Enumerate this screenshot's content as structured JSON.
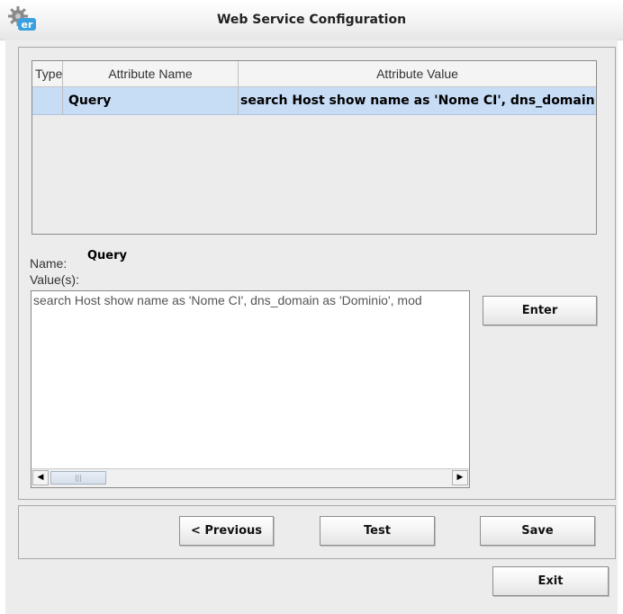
{
  "window": {
    "title": "Web Service Configuration",
    "icon": "gear-er-app-icon"
  },
  "table": {
    "columns": [
      "Type",
      "Attribute Name",
      "Attribute Value"
    ],
    "rows": [
      {
        "type": "",
        "name": "Query",
        "value": "search Host show name as 'Nome CI', dns_domain"
      }
    ]
  },
  "detail": {
    "name_label": "Name:",
    "name_value": "Query",
    "values_label": "Value(s):",
    "values_text": "search Host show name as 'Nome CI', dns_domain as 'Dominio', mod"
  },
  "buttons": {
    "enter": "Enter",
    "previous": "< Previous",
    "test": "Test",
    "save": "Save",
    "exit": "Exit"
  },
  "scrollbar": {
    "left_arrow": "◀",
    "right_arrow": "▶",
    "grip": "|||"
  }
}
